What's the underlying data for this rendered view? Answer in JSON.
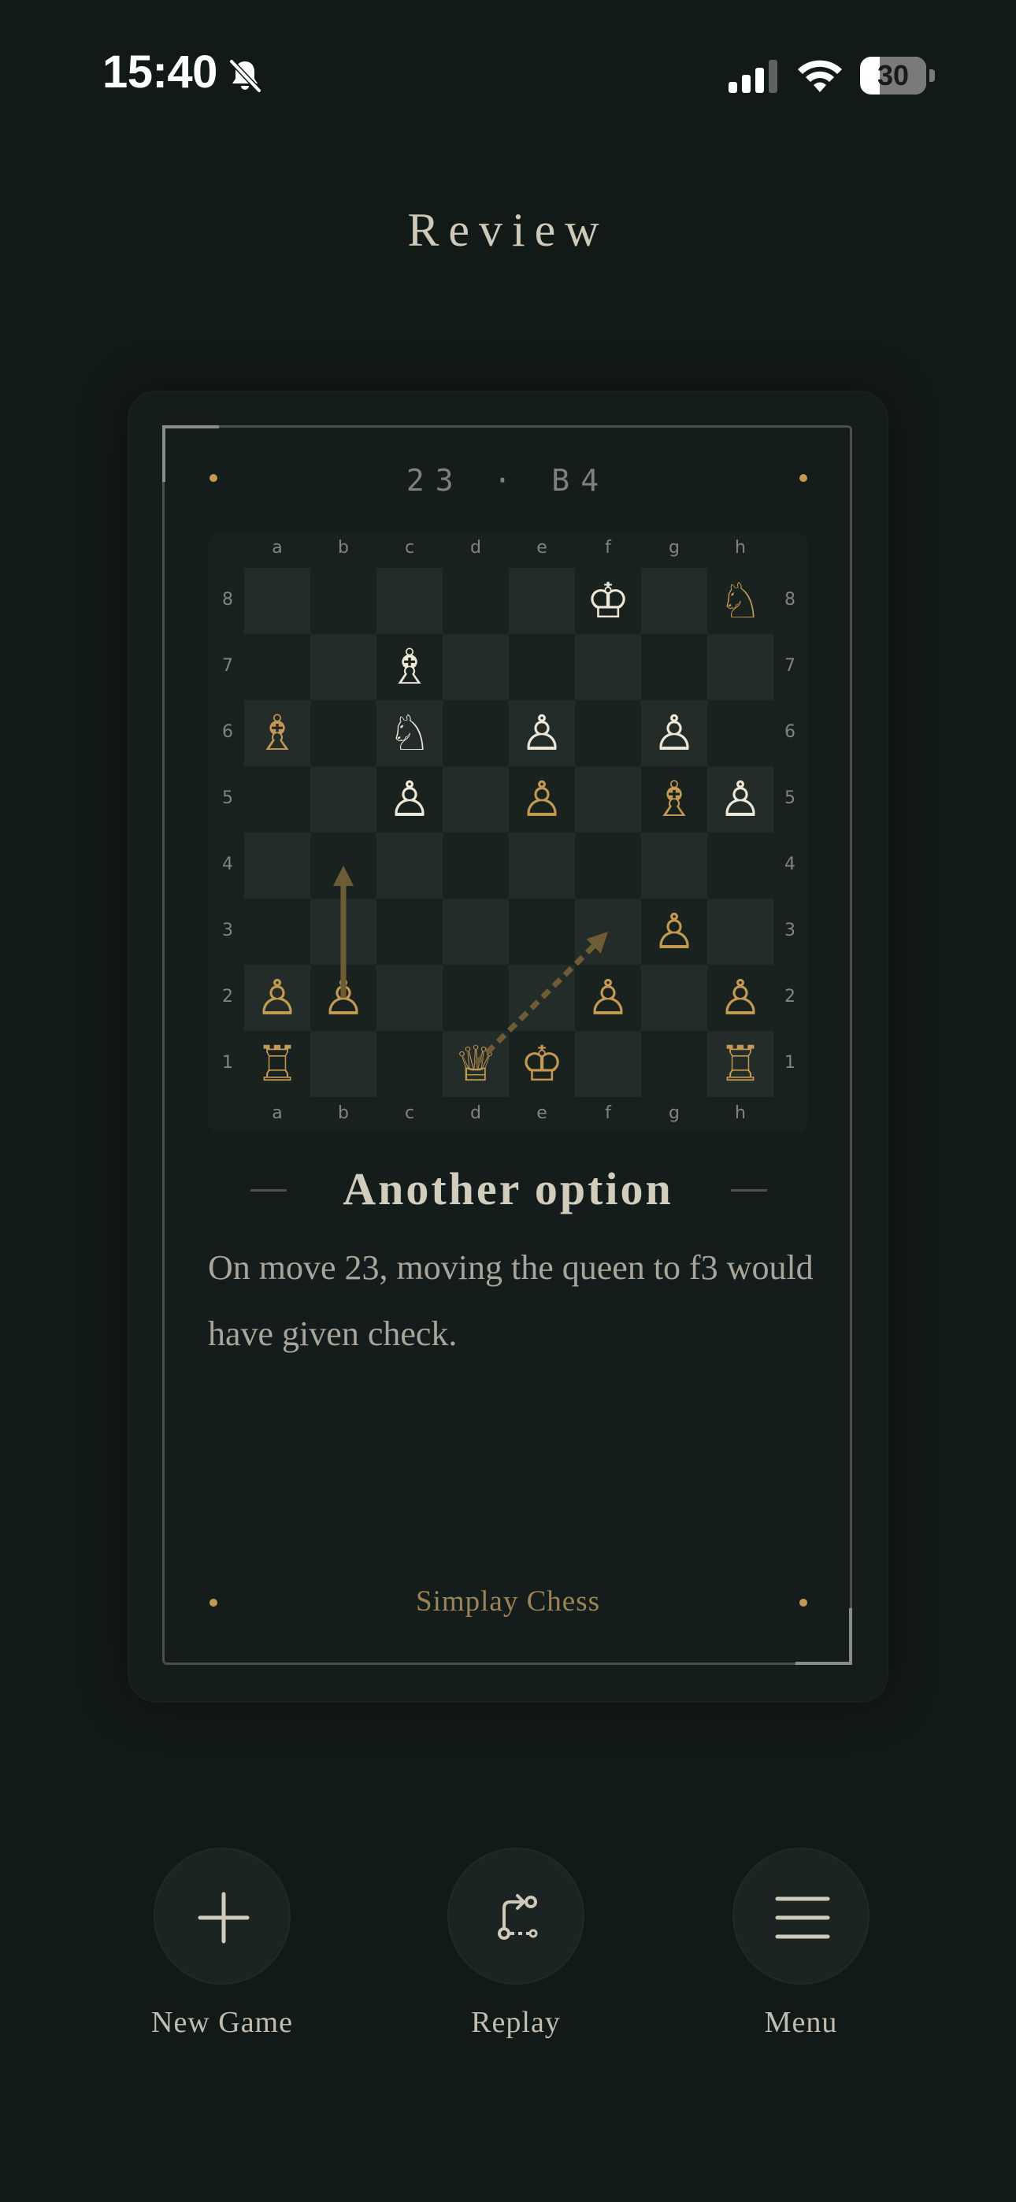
{
  "status_bar": {
    "time": "15:40",
    "battery_level": "30",
    "icons": [
      "bell-slash-icon",
      "cellular-signal-icon",
      "wifi-icon",
      "battery-icon"
    ]
  },
  "page": {
    "title": "Review"
  },
  "card": {
    "move_label": "23 · B4",
    "heading": "Another option",
    "explanation": "On move 23, moving the queen to f3 would have given check.",
    "brand": "Simplay Chess"
  },
  "board": {
    "files": [
      "a",
      "b",
      "c",
      "d",
      "e",
      "f",
      "g",
      "h"
    ],
    "ranks": [
      "8",
      "7",
      "6",
      "5",
      "4",
      "3",
      "2",
      "1"
    ],
    "pieces": [
      {
        "square": "f8",
        "glyph": "♔",
        "side": "white",
        "name": "white-king"
      },
      {
        "square": "h8",
        "glyph": "♘",
        "side": "gold",
        "name": "gold-knight"
      },
      {
        "square": "c7",
        "glyph": "♗",
        "side": "white",
        "name": "white-bishop"
      },
      {
        "square": "a6",
        "glyph": "♗",
        "side": "gold",
        "name": "gold-bishop"
      },
      {
        "square": "c6",
        "glyph": "♘",
        "side": "white",
        "name": "white-knight"
      },
      {
        "square": "e6",
        "glyph": "♙",
        "side": "white",
        "name": "white-pawn"
      },
      {
        "square": "g6",
        "glyph": "♙",
        "side": "white",
        "name": "white-pawn"
      },
      {
        "square": "c5",
        "glyph": "♙",
        "side": "white",
        "name": "white-pawn"
      },
      {
        "square": "e5",
        "glyph": "♙",
        "side": "gold",
        "name": "gold-pawn"
      },
      {
        "square": "g5",
        "glyph": "♗",
        "side": "gold",
        "name": "gold-bishop"
      },
      {
        "square": "h5",
        "glyph": "♙",
        "side": "white",
        "name": "white-pawn"
      },
      {
        "square": "g3",
        "glyph": "♙",
        "side": "gold",
        "name": "gold-pawn"
      },
      {
        "square": "a2",
        "glyph": "♙",
        "side": "gold",
        "name": "gold-pawn"
      },
      {
        "square": "b2",
        "glyph": "♙",
        "side": "gold",
        "name": "gold-pawn"
      },
      {
        "square": "f2",
        "glyph": "♙",
        "side": "gold",
        "name": "gold-pawn"
      },
      {
        "square": "h2",
        "glyph": "♙",
        "side": "gold",
        "name": "gold-pawn"
      },
      {
        "square": "a1",
        "glyph": "♖",
        "side": "gold",
        "name": "gold-rook"
      },
      {
        "square": "d1",
        "glyph": "♕",
        "side": "gold",
        "name": "gold-queen"
      },
      {
        "square": "e1",
        "glyph": "♔",
        "side": "gold",
        "name": "gold-king"
      },
      {
        "square": "h1",
        "glyph": "♖",
        "side": "gold",
        "name": "gold-rook"
      }
    ],
    "arrows": [
      {
        "from": "b2",
        "to": "b4",
        "style": "solid",
        "name": "played-move-arrow"
      },
      {
        "from": "d1",
        "to": "f3",
        "style": "dashed",
        "name": "suggested-move-arrow"
      }
    ],
    "colors": {
      "light_square": "#232c29",
      "dark_square": "#1a2220",
      "white_piece": "#ede7d8",
      "gold_piece": "#c49a52",
      "arrow": "#6e5c36"
    }
  },
  "actions": [
    {
      "label": "New Game",
      "icon": "plus-icon"
    },
    {
      "label": "Replay",
      "icon": "replay-path-icon"
    },
    {
      "label": "Menu",
      "icon": "hamburger-menu-icon"
    }
  ],
  "colors": {
    "background": "#121a18",
    "accent_gold": "#c49a52",
    "heading_text": "#d2ccbc",
    "body_text": "#a8a59a"
  }
}
